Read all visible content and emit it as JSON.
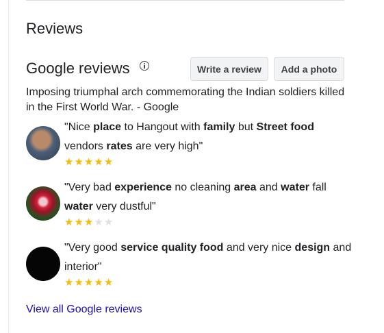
{
  "section_title": "Reviews",
  "google_reviews": {
    "title": "Google reviews",
    "info_icon": "info-icon",
    "write_review_label": "Write a review",
    "add_photo_label": "Add a photo",
    "summary": "Imposing triumphal arch commemorating the Indian soldiers killed in the First World War. - Google"
  },
  "reviews": [
    {
      "segments": [
        {
          "t": "\"Nice ",
          "b": false
        },
        {
          "t": "place",
          "b": true
        },
        {
          "t": " to Hangout with ",
          "b": false
        },
        {
          "t": "family",
          "b": true
        },
        {
          "t": " but ",
          "b": false
        },
        {
          "t": "Street food",
          "b": true
        },
        {
          "t": " vendors ",
          "b": false
        },
        {
          "t": "rates",
          "b": true
        },
        {
          "t": " are very high\"",
          "b": false
        }
      ],
      "rating": 5
    },
    {
      "segments": [
        {
          "t": "\"Very bad ",
          "b": false
        },
        {
          "t": "experience",
          "b": true
        },
        {
          "t": " no cleaning ",
          "b": false
        },
        {
          "t": "area",
          "b": true
        },
        {
          "t": " and ",
          "b": false
        },
        {
          "t": "water",
          "b": true
        },
        {
          "t": " fall ",
          "b": false
        },
        {
          "t": "water",
          "b": true
        },
        {
          "t": " very dustful\"",
          "b": false
        }
      ],
      "rating": 3
    },
    {
      "segments": [
        {
          "t": "\"Very good ",
          "b": false
        },
        {
          "t": "service quality food",
          "b": true
        },
        {
          "t": " and very nice ",
          "b": false
        },
        {
          "t": "design",
          "b": true
        },
        {
          "t": " and interior\"",
          "b": false
        }
      ],
      "rating": 5
    }
  ],
  "max_rating": 5,
  "view_all_label": "View all Google reviews",
  "colors": {
    "star_filled": "#f5bb0c",
    "star_empty": "#e0e0e0",
    "link": "#1a0dab"
  }
}
